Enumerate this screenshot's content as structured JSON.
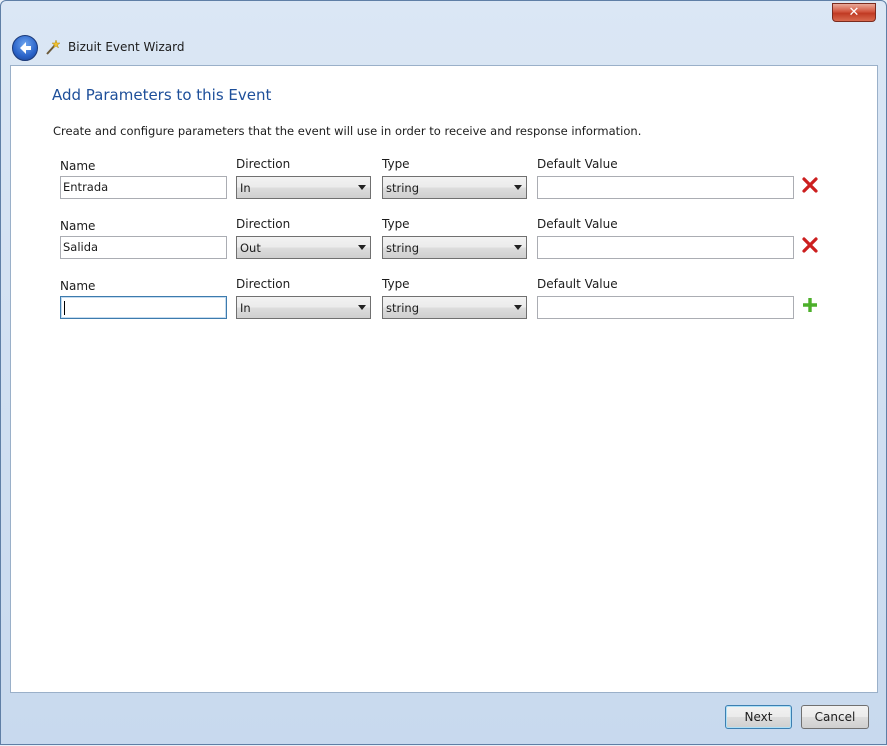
{
  "window": {
    "title": "Bizuit Event Wizard",
    "close_glyph": "✕"
  },
  "page": {
    "title": "Add Parameters to this Event",
    "description": "Create and configure parameters that the event will use in order to receive and response information."
  },
  "labels": {
    "name": "Name",
    "direction": "Direction",
    "type": "Type",
    "default_value": "Default Value"
  },
  "parameters": [
    {
      "name": "Entrada",
      "direction": "In",
      "type": "string",
      "default_value": "",
      "action": "delete"
    },
    {
      "name": "Salida",
      "direction": "Out",
      "type": "string",
      "default_value": "",
      "action": "delete"
    },
    {
      "name": "",
      "direction": "In",
      "type": "string",
      "default_value": "",
      "action": "add"
    }
  ],
  "buttons": {
    "next": "Next",
    "cancel": "Cancel"
  },
  "colors": {
    "title_blue": "#1e4f9a",
    "delete_red": "#cc1f1f",
    "add_green": "#4caf2a"
  },
  "icons": {
    "back": "back-arrow-icon",
    "wizard": "wand-icon",
    "delete": "red-x-icon",
    "add": "green-plus-icon"
  }
}
